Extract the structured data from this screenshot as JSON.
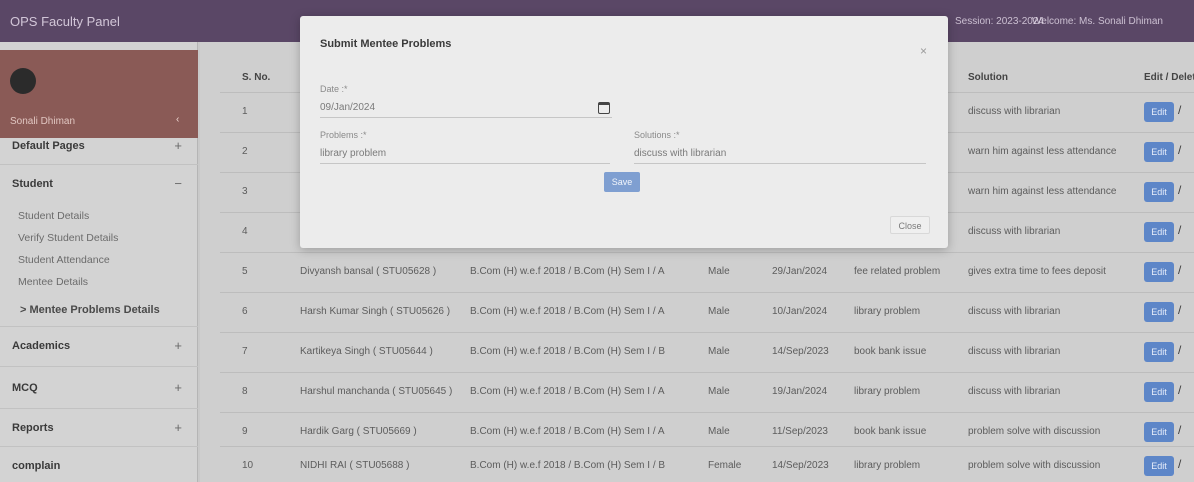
{
  "header": {
    "brand": "OPS Faculty Panel",
    "session": "Session: 2023-2024",
    "welcome": "Welcome: Ms. Sonali Dhiman"
  },
  "sidebar": {
    "profile_name": "Sonali Dhiman",
    "items": [
      {
        "label": "Default Pages",
        "toggle": "+"
      },
      {
        "label": "Student",
        "toggle": "−"
      },
      {
        "label": "Student Details"
      },
      {
        "label": "Verify Student Details"
      },
      {
        "label": "Student Attendance"
      },
      {
        "label": "Mentee Details"
      },
      {
        "label": "> Mentee Problems Details"
      },
      {
        "label": "Academics",
        "toggle": "+"
      },
      {
        "label": "MCQ",
        "toggle": "+"
      },
      {
        "label": "Reports",
        "toggle": "+"
      },
      {
        "label": "complain"
      }
    ]
  },
  "table": {
    "headers": {
      "sno": "S. No.",
      "solution": "Solution",
      "edit": "Edit / Delete"
    },
    "rows": [
      {
        "sno": "1",
        "name": "",
        "course": "",
        "gender": "",
        "date": "",
        "problem": "",
        "solution": "discuss with librarian",
        "edit": "Edit"
      },
      {
        "sno": "2",
        "name": "",
        "course": "",
        "gender": "",
        "date": "",
        "problem": "",
        "solution": "warn him against less attendance",
        "edit": "Edit"
      },
      {
        "sno": "3",
        "name": "",
        "course": "",
        "gender": "",
        "date": "",
        "problem": "",
        "solution": "warn him against less attendance",
        "edit": "Edit"
      },
      {
        "sno": "4",
        "name": "",
        "course": "",
        "gender": "",
        "date": "",
        "problem": "",
        "solution": "discuss with librarian",
        "edit": "Edit"
      },
      {
        "sno": "5",
        "name": "Divyansh bansal ( STU05628 )",
        "course": "B.Com (H) w.e.f 2018 / B.Com (H) Sem I / A",
        "gender": "Male",
        "date": "29/Jan/2024",
        "problem": "fee related problem",
        "solution": "gives extra time to fees deposit",
        "edit": "Edit"
      },
      {
        "sno": "6",
        "name": "Harsh Kumar Singh ( STU05626 )",
        "course": "B.Com (H) w.e.f 2018 / B.Com (H) Sem I / A",
        "gender": "Male",
        "date": "10/Jan/2024",
        "problem": "library problem",
        "solution": "discuss with librarian",
        "edit": "Edit"
      },
      {
        "sno": "7",
        "name": "Kartikeya Singh ( STU05644 )",
        "course": "B.Com (H) w.e.f 2018 / B.Com (H) Sem I / B",
        "gender": "Male",
        "date": "14/Sep/2023",
        "problem": "book bank issue",
        "solution": "discuss with librarian",
        "edit": "Edit"
      },
      {
        "sno": "8",
        "name": "Harshul manchanda ( STU05645 )",
        "course": "B.Com (H) w.e.f 2018 / B.Com (H) Sem I / A",
        "gender": "Male",
        "date": "19/Jan/2024",
        "problem": "library problem",
        "solution": "discuss with librarian",
        "edit": "Edit"
      },
      {
        "sno": "9",
        "name": "Hardik Garg ( STU05669 )",
        "course": "B.Com (H) w.e.f 2018 / B.Com (H) Sem I / A",
        "gender": "Male",
        "date": "11/Sep/2023",
        "problem": "book bank issue",
        "solution": "problem solve with discussion",
        "edit": "Edit"
      },
      {
        "sno": "10",
        "name": "NIDHI RAI ( STU05688 )",
        "course": "B.Com (H) w.e.f 2018 / B.Com (H) Sem I / B",
        "gender": "Female",
        "date": "14/Sep/2023",
        "problem": "library problem",
        "solution": "problem solve with discussion",
        "edit": "Edit"
      }
    ]
  },
  "modal": {
    "title": "Submit Mentee Problems",
    "close_x": "×",
    "date_label": "Date :*",
    "date_value": "09/Jan/2024",
    "problems_label": "Problems :*",
    "problems_value": "library problem",
    "solutions_label": "Solutions :*",
    "solutions_value": "discuss with librarian",
    "save_label": "Save",
    "close_label": "Close"
  }
}
